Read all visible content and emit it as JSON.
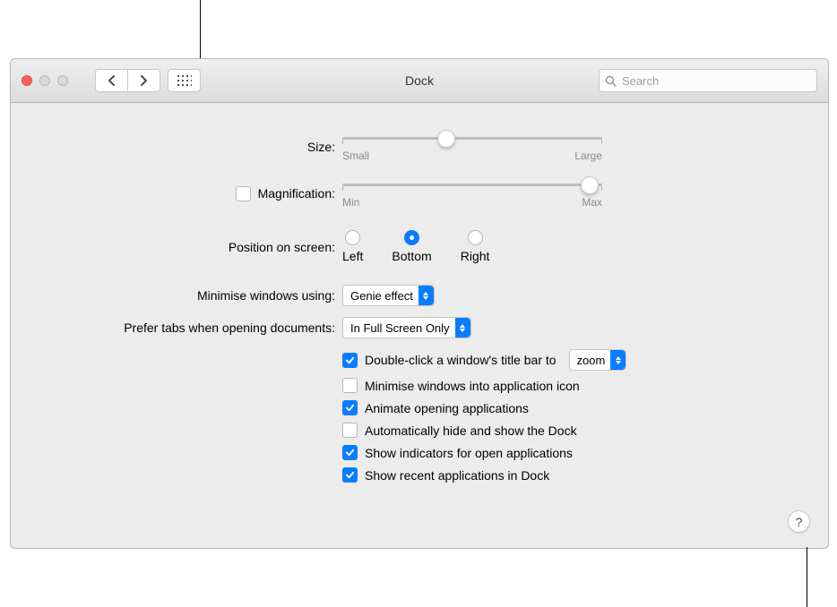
{
  "window": {
    "title": "Dock"
  },
  "search": {
    "placeholder": "Search"
  },
  "size": {
    "label": "Size:",
    "value_pct": 40,
    "min_label": "Small",
    "max_label": "Large"
  },
  "magnification": {
    "label": "Magnification:",
    "enabled": false,
    "value_pct": 95,
    "min_label": "Min",
    "max_label": "Max"
  },
  "position": {
    "label": "Position on screen:",
    "options": [
      "Left",
      "Bottom",
      "Right"
    ],
    "selected_index": 1
  },
  "minimise_effect": {
    "label": "Minimise windows using:",
    "value": "Genie effect"
  },
  "tabs_pref": {
    "label": "Prefer tabs when opening documents:",
    "value": "In Full Screen Only"
  },
  "doubleclick": {
    "checked": true,
    "label": "Double-click a window's title bar to",
    "dropdown_value": "zoom"
  },
  "options": [
    {
      "checked": false,
      "label": "Minimise windows into application icon"
    },
    {
      "checked": true,
      "label": "Animate opening applications"
    },
    {
      "checked": false,
      "label": "Automatically hide and show the Dock"
    },
    {
      "checked": true,
      "label": "Show indicators for open applications"
    },
    {
      "checked": true,
      "label": "Show recent applications in Dock"
    }
  ],
  "help": {
    "label": "?"
  }
}
